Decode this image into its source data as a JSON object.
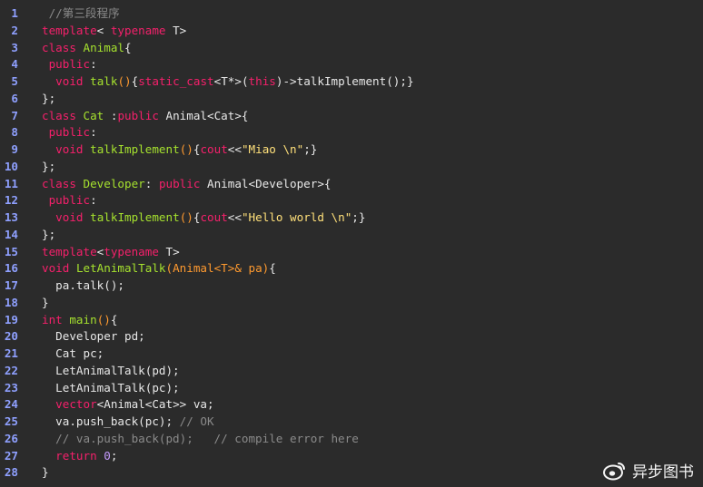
{
  "editor": {
    "colors": {
      "background": "#2b2b2b",
      "line_number": "#8fa0ff",
      "keyword": "#f5206b",
      "type_name": "#a6e22e",
      "text": "#e8e8e8",
      "string": "#ffe07a",
      "comment": "#8a8a8a",
      "operator": "#ff9a2f",
      "number": "#c59bff"
    },
    "lines": [
      {
        "num": "1",
        "segs": [
          [
            "c",
            " //第三段程序"
          ]
        ]
      },
      {
        "num": "2",
        "segs": [
          [
            "k",
            "template"
          ],
          [
            "w",
            "< "
          ],
          [
            "k",
            "typename"
          ],
          [
            "w",
            " T>"
          ]
        ]
      },
      {
        "num": "3",
        "segs": [
          [
            "k",
            "class"
          ],
          [
            "w",
            " "
          ],
          [
            "t",
            "Animal"
          ],
          [
            "w",
            "{"
          ]
        ]
      },
      {
        "num": "4",
        "segs": [
          [
            "w",
            " "
          ],
          [
            "k",
            "public"
          ],
          [
            "w",
            ":"
          ]
        ]
      },
      {
        "num": "5",
        "segs": [
          [
            "w",
            "  "
          ],
          [
            "k",
            "void"
          ],
          [
            "w",
            " "
          ],
          [
            "t",
            "talk"
          ],
          [
            "o",
            "()"
          ],
          [
            "w",
            "{"
          ],
          [
            "k",
            "static_cast"
          ],
          [
            "w",
            "<T*>("
          ],
          [
            "k",
            "this"
          ],
          [
            "w",
            ")->talkImplement();}"
          ]
        ]
      },
      {
        "num": "6",
        "segs": [
          [
            "w",
            "};"
          ]
        ]
      },
      {
        "num": "7",
        "segs": [
          [
            "k",
            "class"
          ],
          [
            "w",
            " "
          ],
          [
            "t",
            "Cat"
          ],
          [
            "w",
            " :"
          ],
          [
            "k",
            "public"
          ],
          [
            "w",
            " Animal<Cat>{"
          ]
        ]
      },
      {
        "num": "8",
        "segs": [
          [
            "w",
            " "
          ],
          [
            "k",
            "public"
          ],
          [
            "w",
            ":"
          ]
        ]
      },
      {
        "num": "9",
        "segs": [
          [
            "w",
            "  "
          ],
          [
            "k",
            "void"
          ],
          [
            "w",
            " "
          ],
          [
            "t",
            "talkImplement"
          ],
          [
            "o",
            "()"
          ],
          [
            "w",
            "{"
          ],
          [
            "k",
            "cout"
          ],
          [
            "w",
            "<<"
          ],
          [
            "s",
            "\"Miao \\n\""
          ],
          [
            "w",
            ";}"
          ]
        ]
      },
      {
        "num": "10",
        "segs": [
          [
            "w",
            "};"
          ]
        ]
      },
      {
        "num": "11",
        "segs": [
          [
            "k",
            "class"
          ],
          [
            "w",
            " "
          ],
          [
            "t",
            "Developer"
          ],
          [
            "w",
            ": "
          ],
          [
            "k",
            "public"
          ],
          [
            "w",
            " Animal<Developer>{"
          ]
        ]
      },
      {
        "num": "12",
        "segs": [
          [
            "w",
            " "
          ],
          [
            "k",
            "public"
          ],
          [
            "w",
            ":"
          ]
        ]
      },
      {
        "num": "13",
        "segs": [
          [
            "w",
            "  "
          ],
          [
            "k",
            "void"
          ],
          [
            "w",
            " "
          ],
          [
            "t",
            "talkImplement"
          ],
          [
            "o",
            "()"
          ],
          [
            "w",
            "{"
          ],
          [
            "k",
            "cout"
          ],
          [
            "w",
            "<<"
          ],
          [
            "s",
            "\"Hello world \\n\""
          ],
          [
            "w",
            ";}"
          ]
        ]
      },
      {
        "num": "14",
        "segs": [
          [
            "w",
            "};"
          ]
        ]
      },
      {
        "num": "15",
        "segs": [
          [
            "k",
            "template"
          ],
          [
            "w",
            "<"
          ],
          [
            "k",
            "typename"
          ],
          [
            "w",
            " T>"
          ]
        ]
      },
      {
        "num": "16",
        "segs": [
          [
            "k",
            "void"
          ],
          [
            "w",
            " "
          ],
          [
            "t",
            "LetAnimalTalk"
          ],
          [
            "o",
            "(Animal<T>& pa)"
          ],
          [
            "w",
            "{"
          ]
        ]
      },
      {
        "num": "17",
        "segs": [
          [
            "w",
            "  pa.talk();"
          ]
        ]
      },
      {
        "num": "18",
        "segs": [
          [
            "w",
            "}"
          ]
        ]
      },
      {
        "num": "19",
        "segs": [
          [
            "k",
            "int"
          ],
          [
            "w",
            " "
          ],
          [
            "t",
            "main"
          ],
          [
            "o",
            "()"
          ],
          [
            "w",
            "{"
          ]
        ]
      },
      {
        "num": "20",
        "segs": [
          [
            "w",
            "  Developer pd;"
          ]
        ]
      },
      {
        "num": "21",
        "segs": [
          [
            "w",
            "  Cat pc;"
          ]
        ]
      },
      {
        "num": "22",
        "segs": [
          [
            "w",
            "  LetAnimalTalk(pd);"
          ]
        ]
      },
      {
        "num": "23",
        "segs": [
          [
            "w",
            "  LetAnimalTalk(pc);"
          ]
        ]
      },
      {
        "num": "24",
        "segs": [
          [
            "w",
            "  "
          ],
          [
            "k",
            "vector"
          ],
          [
            "w",
            "<Animal<Cat>> va;"
          ]
        ]
      },
      {
        "num": "25",
        "segs": [
          [
            "w",
            "  va.push_back(pc); "
          ],
          [
            "c",
            "// OK"
          ]
        ]
      },
      {
        "num": "26",
        "segs": [
          [
            "c",
            "  // va.push_back(pd);   // compile error here"
          ]
        ]
      },
      {
        "num": "27",
        "segs": [
          [
            "w",
            "  "
          ],
          [
            "k",
            "return"
          ],
          [
            "w",
            " "
          ],
          [
            "n",
            "0"
          ],
          [
            "w",
            ";"
          ]
        ]
      },
      {
        "num": "28",
        "segs": [
          [
            "w",
            "}"
          ]
        ]
      }
    ]
  },
  "watermark": {
    "icon": "weibo-icon",
    "text": "异步图书"
  }
}
